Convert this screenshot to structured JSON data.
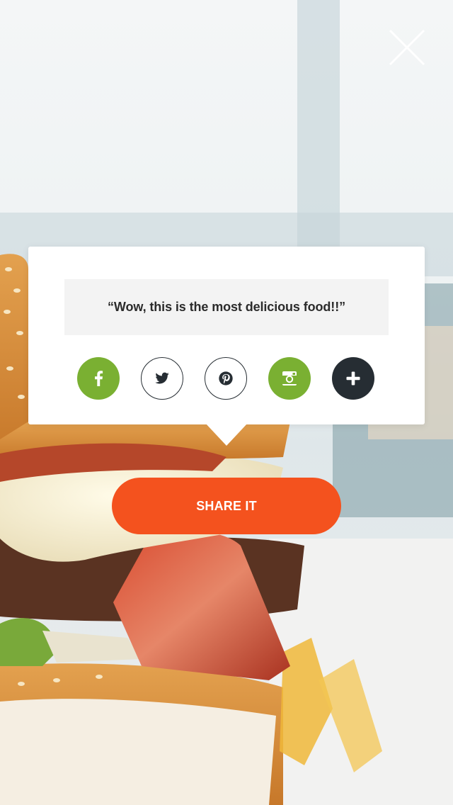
{
  "popup": {
    "quote": "“Wow, this is the most delicious food!!”"
  },
  "social": [
    {
      "name": "facebook-icon",
      "bg": "#7ab032",
      "style": "filled"
    },
    {
      "name": "twitter-icon",
      "bg": "#ffffff",
      "style": "outline"
    },
    {
      "name": "pinterest-icon",
      "bg": "#ffffff",
      "style": "outline"
    },
    {
      "name": "instagram-icon",
      "bg": "#7ab032",
      "style": "filled"
    },
    {
      "name": "plus-icon",
      "bg": "#262d33",
      "style": "filled"
    }
  ],
  "share_button": {
    "label": "SHARE IT",
    "bg": "#f4521e"
  },
  "close_icon": "close-icon",
  "colors": {
    "accent_green": "#7ab032",
    "accent_orange": "#f4521e",
    "dark": "#262d33"
  }
}
